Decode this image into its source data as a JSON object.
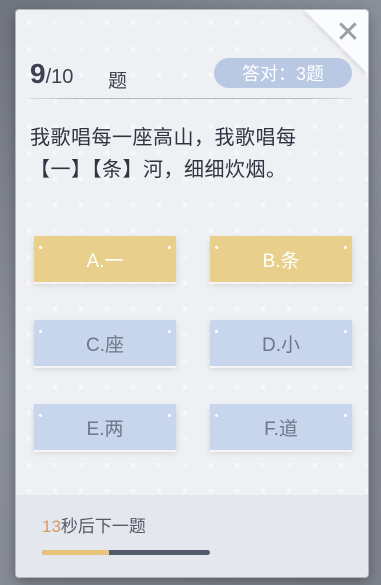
{
  "quiz": {
    "current": "9",
    "separator": "/",
    "total": "10",
    "question_label": "题",
    "correct_count_label": "答对：3题",
    "question_line1": "我歌唱每一座高山，我歌唱每",
    "question_line2": "【一】【条】河，细细炊烟。",
    "options": [
      {
        "label": "A.一",
        "style": "selected"
      },
      {
        "label": "B.条",
        "style": "selected"
      },
      {
        "label": "C.座",
        "style": "normal"
      },
      {
        "label": "D.小",
        "style": "normal"
      },
      {
        "label": "E.两",
        "style": "normal"
      },
      {
        "label": "F.道",
        "style": "normal"
      }
    ],
    "timer_seconds": "13",
    "timer_suffix": "秒后下一题",
    "timer_progress": 0.4
  },
  "icons": {
    "close": "close-icon"
  },
  "colors": {
    "selected_option": "#e8cf8b",
    "normal_option": "#c7d6ec",
    "badge": "#b9c8e3",
    "progress_fill": "#e8c37a",
    "progress_track": "#535a6d",
    "timer_seconds": "#d69a63"
  }
}
